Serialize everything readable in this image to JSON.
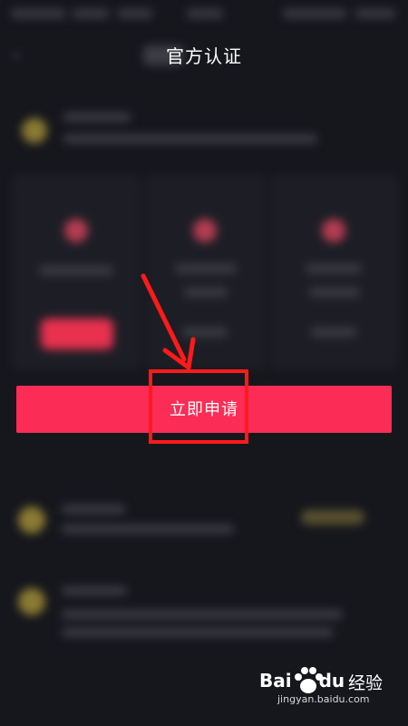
{
  "header": {
    "title": "官方认证",
    "back_icon": "chevron-left-icon"
  },
  "apply_button": {
    "label": "立即申请"
  },
  "watermark": {
    "brand": "Bai",
    "brand2": "du",
    "jingyan": "经验",
    "url": "jingyan.baidu.com"
  },
  "colors": {
    "background": "#16171d",
    "primary": "#fb2c55",
    "annotation": "#ff1a1a",
    "coin": "#8a7a33"
  }
}
